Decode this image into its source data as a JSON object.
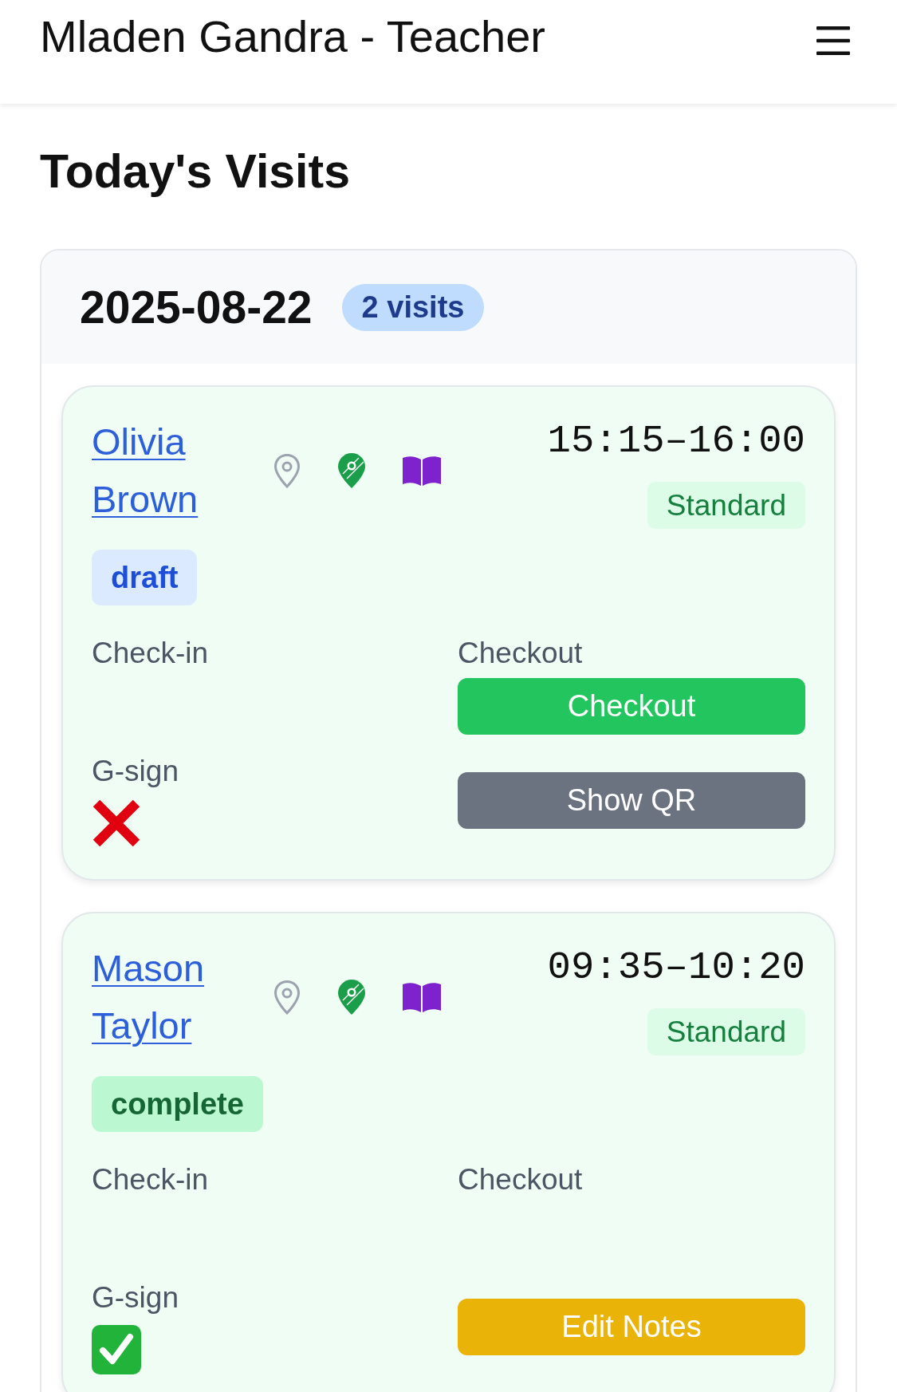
{
  "header": {
    "title": "Mladen Gandra - Teacher"
  },
  "page_title": "Today's Visits",
  "day": {
    "date": "2025-08-22",
    "count": "2 visits",
    "visits": [
      {
        "student": "Olivia Brown",
        "time": "15:15–16:00",
        "type": "Standard",
        "status": {
          "label": "draft",
          "kind": "draft"
        },
        "checkin": {
          "label": "Check-in"
        },
        "checkout": {
          "label": "Checkout",
          "button": {
            "label": "Checkout",
            "kind": "checkout"
          }
        },
        "gsign": {
          "label": "G-sign",
          "signed": false
        },
        "action": {
          "label": "Show QR",
          "kind": "qr"
        }
      },
      {
        "student": "Mason Taylor",
        "time": "09:35–10:20",
        "type": "Standard",
        "status": {
          "label": "complete",
          "kind": "complete"
        },
        "checkin": {
          "label": "Check-in"
        },
        "checkout": {
          "label": "Checkout"
        },
        "gsign": {
          "label": "G-sign",
          "signed": true
        },
        "action": {
          "label": "Edit Notes",
          "kind": "notes"
        }
      }
    ]
  }
}
